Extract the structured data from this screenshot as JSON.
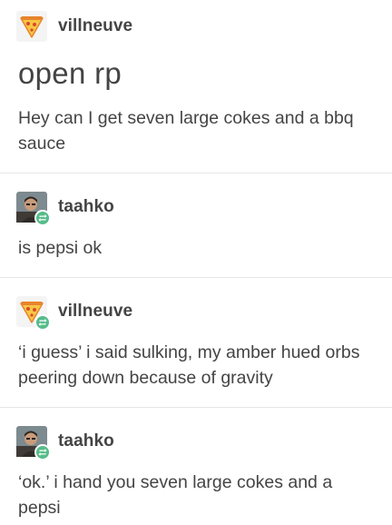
{
  "posts": [
    {
      "username": "villneuve",
      "avatar_icon": "pizza-slice-icon",
      "reblog": false,
      "title": "open rp",
      "body": "Hey can I get seven large cokes and a bbq sauce"
    },
    {
      "username": "taahko",
      "avatar_icon": "user-photo-avatar",
      "reblog": true,
      "body": "is pepsi ok"
    },
    {
      "username": "villneuve",
      "avatar_icon": "pizza-slice-icon",
      "reblog": true,
      "body": "‘i guess’ i said sulking, my amber hued orbs peering down because of gravity"
    },
    {
      "username": "taahko",
      "avatar_icon": "user-photo-avatar",
      "reblog": true,
      "body": "‘ok.’ i hand you seven large cokes and a pepsi"
    }
  ],
  "colors": {
    "text": "#444444",
    "divider": "#e6e6e6",
    "reblog_badge": "#56bc8a",
    "pizza_crust": "#e8842c",
    "pizza_cheese": "#f6c744"
  }
}
